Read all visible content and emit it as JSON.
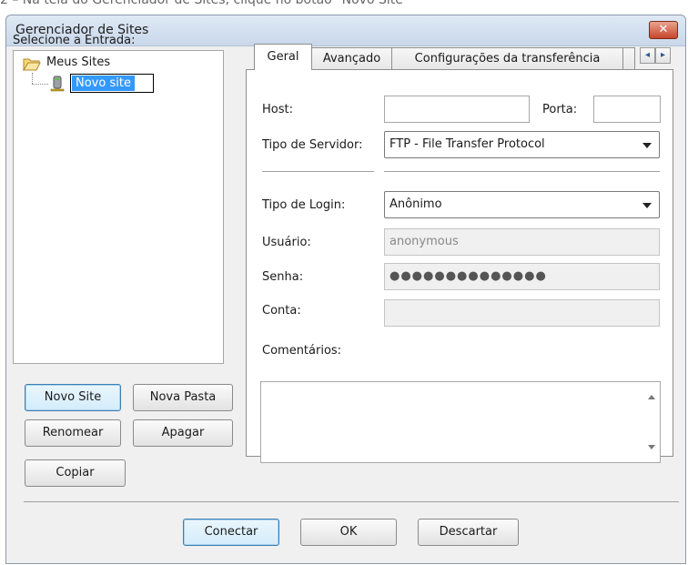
{
  "caption": "2 – Na tela do Gerenciador de Sites, clique no botão \"Novo Site\"",
  "window": {
    "title": "Gerenciador de Sites",
    "close_symbol": "✕"
  },
  "tree": {
    "label": "Selecione a Entrada:",
    "root": "Meus Sites",
    "child_editing": "Novo site"
  },
  "left_buttons": {
    "new_site": "Novo Site",
    "new_folder": "Nova Pasta",
    "rename": "Renomear",
    "delete": "Apagar",
    "copy": "Copiar"
  },
  "tabs": {
    "general": "Geral",
    "advanced": "Avançado",
    "transfer": "Configurações da transferência",
    "scroll_left": "◂",
    "scroll_right": "▸"
  },
  "general": {
    "host_label": "Host:",
    "host_value": "",
    "port_label": "Porta:",
    "port_value": "",
    "server_type_label": "Tipo de Servidor:",
    "server_type_value": "FTP - File Transfer Protocol",
    "login_type_label": "Tipo de Login:",
    "login_type_value": "Anônimo",
    "user_label": "Usuário:",
    "user_value": "anonymous",
    "password_label": "Senha:",
    "password_value": "●●●●●●●●●●●●●●",
    "account_label": "Conta:",
    "account_value": "",
    "comments_label": "Comentários:",
    "comments_value": ""
  },
  "footer_buttons": {
    "connect": "Conectar",
    "ok": "OK",
    "discard": "Descartar"
  },
  "colors": {
    "selection": "#3399ff",
    "close_button": "#c8452c",
    "window_bg": "#f0f0f0"
  }
}
